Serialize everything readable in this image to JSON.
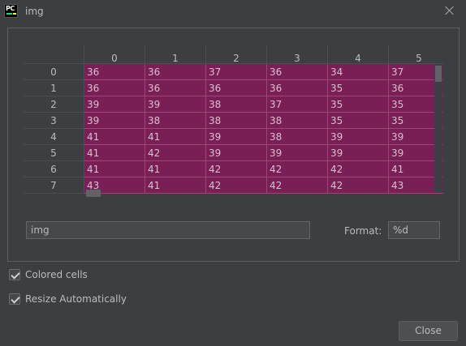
{
  "window": {
    "title": "img",
    "app_icon_text": "PC"
  },
  "table": {
    "columns": [
      "0",
      "1",
      "2",
      "3",
      "4",
      "5"
    ],
    "row_labels": [
      "0",
      "1",
      "2",
      "3",
      "4",
      "5",
      "6",
      "7"
    ],
    "rows": [
      [
        "36",
        "36",
        "37",
        "36",
        "34",
        "37"
      ],
      [
        "36",
        "36",
        "36",
        "36",
        "35",
        "36"
      ],
      [
        "39",
        "39",
        "38",
        "37",
        "35",
        "35"
      ],
      [
        "39",
        "38",
        "38",
        "38",
        "35",
        "35"
      ],
      [
        "41",
        "41",
        "39",
        "38",
        "39",
        "39"
      ],
      [
        "41",
        "42",
        "39",
        "39",
        "39",
        "39"
      ],
      [
        "41",
        "41",
        "42",
        "42",
        "42",
        "41"
      ],
      [
        "43",
        "41",
        "42",
        "42",
        "42",
        "43"
      ]
    ]
  },
  "expression": {
    "value": "img"
  },
  "format": {
    "label": "Format:",
    "value": "%d"
  },
  "options": {
    "colored_cells": {
      "label": "Colored cells",
      "checked": true
    },
    "resize_automatically": {
      "label": "Resize Automatically",
      "checked": true
    }
  },
  "buttons": {
    "close_label": "Close"
  },
  "colors": {
    "cell_bg": "#7a1f56",
    "window_bg": "#3c3f41"
  }
}
